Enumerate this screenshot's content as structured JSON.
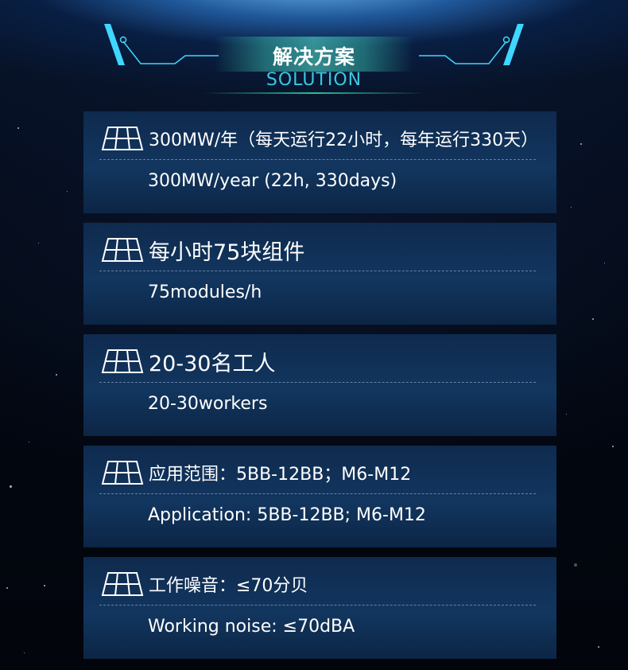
{
  "header": {
    "title_cn": "解决方案",
    "title_en": "SOLUTION"
  },
  "colors": {
    "accent_cyan": "#39c8e0",
    "card_bg": "#12365f",
    "background": "#02060f"
  },
  "cards": [
    {
      "icon": "solar-panel-icon",
      "cn": "300MW/年（每天运行22小时，每年运行330天）",
      "en": "300MW/year (22h, 330days)"
    },
    {
      "icon": "solar-panel-icon",
      "cn": "每小时75块组件",
      "en": "75modules/h"
    },
    {
      "icon": "solar-panel-icon",
      "cn": "20-30名工人",
      "en": "20-30workers"
    },
    {
      "icon": "solar-panel-icon",
      "cn": "应用范围：5BB-12BB；M6-M12",
      "en": "Application: 5BB-12BB; M6-M12"
    },
    {
      "icon": "solar-panel-icon",
      "cn": "工作噪音：≤70分贝",
      "en": "Working noise: ≤70dBA"
    }
  ]
}
